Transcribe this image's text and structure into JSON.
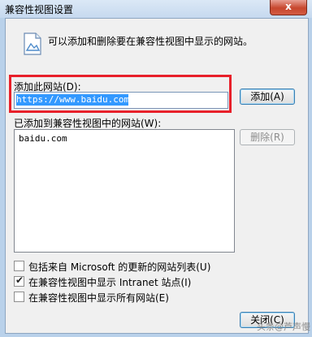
{
  "window": {
    "title": "兼容性视图设置",
    "close_glyph": "x"
  },
  "info": {
    "text": "可以添加和删除要在兼容性视图中显示的网站。"
  },
  "add_site": {
    "label": "添加此网站(D):",
    "value": "https://www.baidu.com/",
    "button": "添加(A)"
  },
  "site_list": {
    "label": "已添加到兼容性视图中的网站(W):",
    "items": [
      "baidu.com"
    ],
    "remove_button": "删除(R)"
  },
  "options": [
    {
      "label": "包括来自 Microsoft 的更新的网站列表(U)",
      "checked": false
    },
    {
      "label": "在兼容性视图中显示 Intranet 站点(I)",
      "checked": true
    },
    {
      "label": "在兼容性视图中显示所有网站(E)",
      "checked": false
    }
  ],
  "footer": {
    "close_button": "关闭(C)",
    "watermark": "头条@芦声慢"
  }
}
